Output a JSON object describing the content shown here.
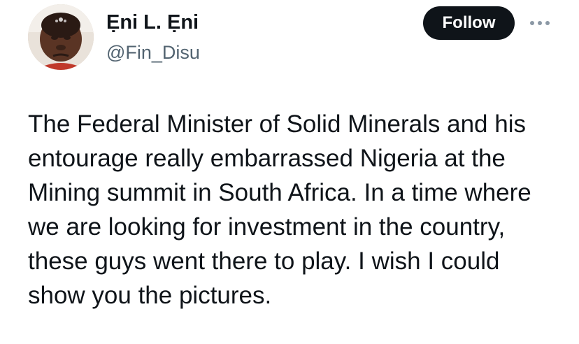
{
  "author": {
    "display_name": "Ẹni L. Ẹni",
    "handle": "@Fin_Disu",
    "avatar_alt": "avatar"
  },
  "actions": {
    "follow_label": "Follow",
    "more_icon": "more-horizontal-icon"
  },
  "tweet": {
    "lines": [
      "The Federal Minister of Solid Minerals and his",
      "entourage really embarrassed Nigeria at the",
      "Mining summit in South Africa. In a time where",
      "we are looking for investment in the country,",
      "these guys went there to play. I wish I could",
      "show you the pictures."
    ]
  },
  "colors": {
    "text_primary": "#0f1419",
    "text_secondary": "#536471",
    "follow_bg": "#0f1419",
    "follow_text": "#ffffff",
    "more_icon": "#8b98a5"
  }
}
